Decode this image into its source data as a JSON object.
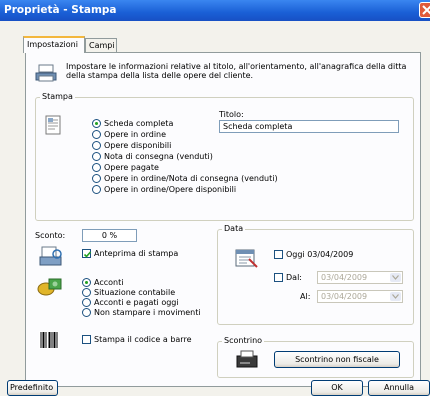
{
  "window": {
    "title": "Proprietà - Stampa"
  },
  "tabs": [
    {
      "label": "Impostazioni"
    },
    {
      "label": "Campi"
    }
  ],
  "intro": {
    "line1": "Impostare le informazioni relative al titolo, all'orientamento, all'anagrafica della ditta",
    "line2": "della stampa della lista delle opere del cliente."
  },
  "stampa": {
    "legend": "Stampa",
    "options": [
      "Scheda completa",
      "Opere in ordine",
      "Opere disponibili",
      "Nota di consegna (venduti)",
      "Opere pagate",
      "Opere in ordine/Nota di consegna (venduti)",
      "Opere in ordine/Opere disponibili"
    ],
    "selected_index": 0,
    "titolo_label": "Titolo:",
    "titolo_value": "Scheda completa"
  },
  "sconto": {
    "label": "Sconto:",
    "value": "0 %"
  },
  "anteprima": {
    "label": "Anteprima di stampa",
    "checked": true
  },
  "pagamento": {
    "options": [
      "Acconti",
      "Situazione contabile",
      "Acconti e pagati oggi",
      "Non stampare i movimenti"
    ],
    "selected_index": 0
  },
  "barcode": {
    "label": "Stampa il codice a barre",
    "checked": false
  },
  "data": {
    "legend": "Data",
    "oggi_label": "Oggi 03/04/2009",
    "dal_label": "Dal:",
    "dal_value": "03/04/2009",
    "al_label": "Al:",
    "al_value": "03/04/2009"
  },
  "scontrino": {
    "legend": "Scontrino",
    "button": "Scontrino non fiscale"
  },
  "footer": {
    "predefinito": "Predefinito",
    "ok": "OK",
    "annulla": "Annulla"
  },
  "colors": {
    "titlebar": "#1a5fd6",
    "dialog_bg": "#f3f2ec",
    "panel_bg": "#fcfcfe",
    "check_green": "#21a121"
  }
}
